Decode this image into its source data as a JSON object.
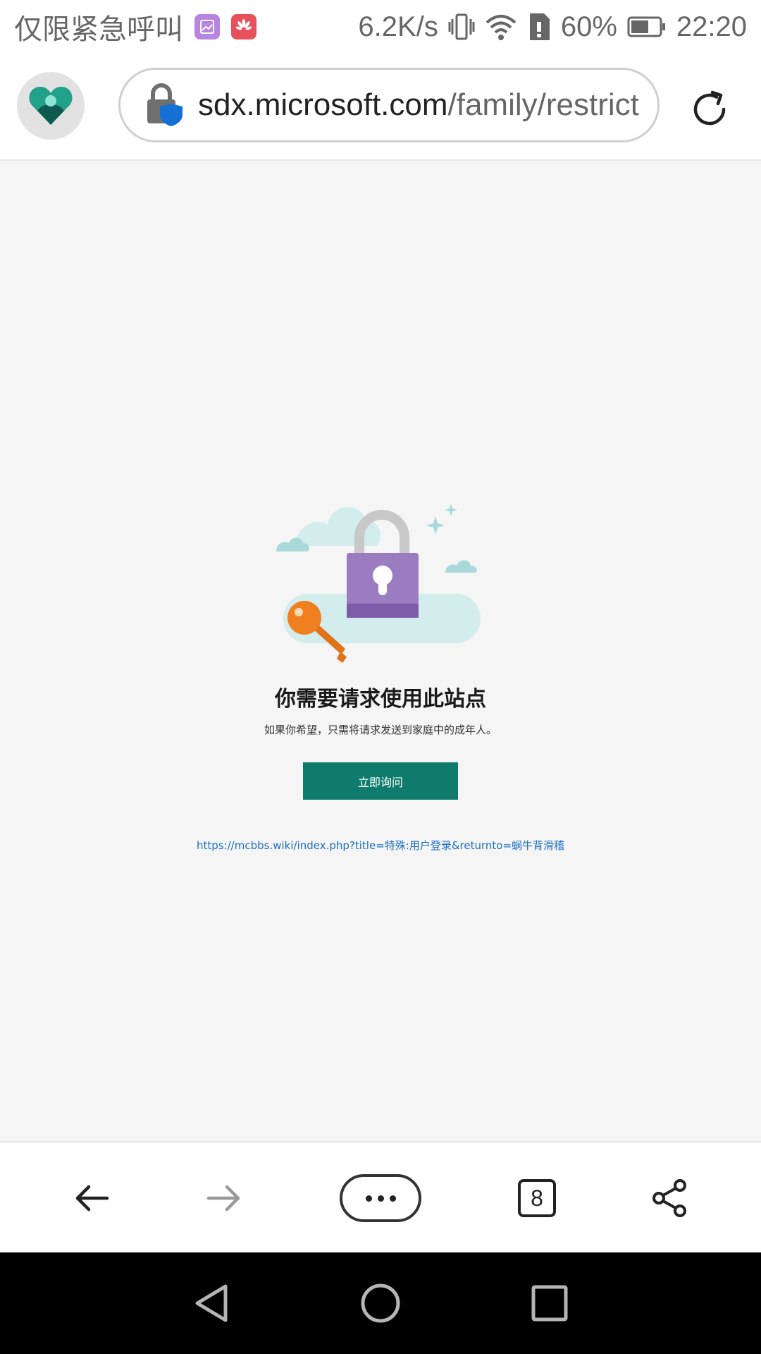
{
  "status_bar": {
    "carrier": "仅限紧急呼叫",
    "speed": "6.2K/s",
    "battery": "60%",
    "time": "22:20",
    "icons": [
      "gallery-app-icon",
      "huawei-app-icon",
      "vibrate-icon",
      "wifi-icon",
      "sim-alert-icon",
      "battery-icon"
    ]
  },
  "address_bar": {
    "url_host": "sdx.microsoft.com",
    "url_path": "/family/restrict",
    "icons": [
      "family-safety-logo-icon",
      "lock-shield-icon",
      "reload-icon"
    ]
  },
  "content": {
    "heading": "你需要请求使用此站点",
    "subtext": "如果你希望，只需将请求发送到家庭中的成年人。",
    "ask_button": "立即询问",
    "blocked_url": "https://mcbbs.wiki/index.php?title=特殊:用户登录&returnto=蜗牛背滑稽",
    "illustration": "padlock-key-clouds-illustration"
  },
  "toolbar": {
    "tab_count": "8",
    "icons": [
      "back-arrow-icon",
      "forward-arrow-icon",
      "more-icon",
      "tabs-icon",
      "share-icon"
    ]
  },
  "nav_bar": {
    "icons": [
      "nav-back-icon",
      "nav-home-icon",
      "nav-recents-icon"
    ]
  },
  "colors": {
    "accent_button": "#0f7b6c",
    "link": "#1b6fc4",
    "background": "#f5f5f5",
    "padlock": "#9b7cc0",
    "key": "#f0801f"
  }
}
